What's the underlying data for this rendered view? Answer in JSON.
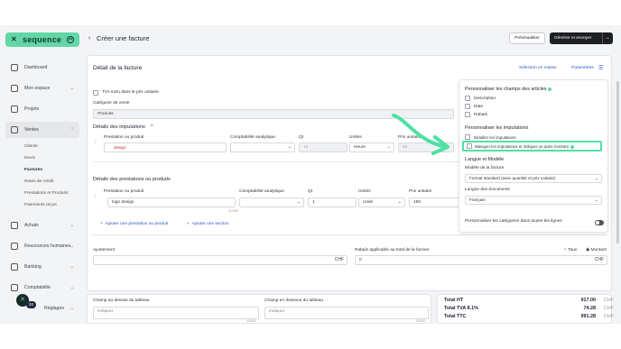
{
  "sidebar": {
    "brand": "sequence",
    "brand_mark": "✕",
    "items": [
      {
        "label": "Dashboard",
        "icon": "home-icon"
      },
      {
        "label": "Mon espace",
        "icon": "user-icon",
        "chev": "⌄"
      },
      {
        "label": "Projets",
        "icon": "check-square-icon"
      },
      {
        "label": "Ventes",
        "icon": "sales-icon",
        "chev": "⌃"
      },
      {
        "label": "Achats",
        "icon": "bag-icon",
        "chev": "⌄"
      },
      {
        "label": "Ressources humaines",
        "icon": "people-icon",
        "chev": "⌄"
      },
      {
        "label": "Banking",
        "icon": "bank-icon",
        "chev": "⌄"
      },
      {
        "label": "Comptabilité",
        "icon": "ledger-icon",
        "chev": "⌄"
      },
      {
        "label": "Réglages",
        "icon": "settings-icon",
        "chev": "⌄"
      }
    ],
    "sub_items": [
      "Clients",
      "Devis",
      "Factures",
      "Notes de crédit",
      "Prestations et Produits",
      "Paiements reçus"
    ],
    "notif_count": "34"
  },
  "header": {
    "back": "‹",
    "title": "Créer une facture",
    "preview_label": "Prévisualiser",
    "send_label": "Générer et envoyer",
    "send_caret": "⌄"
  },
  "main": {
    "section_title": "Détail de la facture",
    "mass_selection": "Sélection en masse",
    "parameters": "Paramètres",
    "tva_label": "TVA inclu dans le prix unitaire",
    "category_label": "Catégorie de vente",
    "category_value": "Produits",
    "imputations_title": "Détails des imputations",
    "imputations_caret": "^",
    "imp_headers": [
      "Prestation ou produit",
      "Comptabilité analytique",
      "Qt",
      "Unités",
      "Prix unitaire"
    ],
    "imp_row": {
      "product": "design",
      "qty": "13",
      "unit": "Heure",
      "price": "59"
    },
    "prestations_title": "Détails des prestations ou produits",
    "pres_headers": [
      "Prestation ou produit",
      "Comptabilité analytique",
      "Qt",
      "Unités",
      "Prix unitaire"
    ],
    "pres_row": {
      "product": "logo design",
      "counter": "11/255",
      "qty": "1",
      "unit": "Unité",
      "price": "150"
    },
    "add_product": "Ajouter une prestation ou produit",
    "add_section": "Ajouter une section",
    "adjustment_label": "Ajustement",
    "adjustment_currency": "CHF",
    "discount_label": "Rabais applicable au total de la facture",
    "discount_value": "0",
    "discount_currency": "CHF",
    "rate_label": "Taux",
    "amount_label": "Montant"
  },
  "bottom": {
    "field_above_label": "Champ au dessus du tableau",
    "field_above_placeholder": "Indiquer",
    "field_below_label": "Champ en dessous du tableau",
    "field_below_placeholder": "Indiquer",
    "counter": "0/2000",
    "totals": [
      {
        "label": "Total HT",
        "value": "917.00",
        "currency": "CHF"
      },
      {
        "label": "Total TVA 8.1%",
        "value": "74.28",
        "currency": "CHF"
      },
      {
        "label": "Total TTC",
        "value": "991.28",
        "currency": "CHF"
      }
    ]
  },
  "panel": {
    "article_title": "Personnaliser les champs des articles",
    "article_fields": [
      "Description",
      "Date",
      "Rabais"
    ],
    "imputations_title": "Personnaliser les imputations",
    "imp_detail": "Détailler les imputations",
    "imp_mask": "Masquer les imputations et indiquer un autre montant",
    "lang_title": "Langue et Modèle",
    "model_label": "Modèle de la facture",
    "model_value": "Format standard (avec quantité et prix unitaire)",
    "docs_lang_label": "Langue des documents",
    "docs_lang_value": "Français",
    "custom_categories": "Personnaliser les catégories dans toutes les lignes"
  },
  "colors": {
    "brand": "#62d6a7",
    "highlight": "#4fe0a4",
    "link": "#2a56c6",
    "dark": "#1d1f24"
  }
}
